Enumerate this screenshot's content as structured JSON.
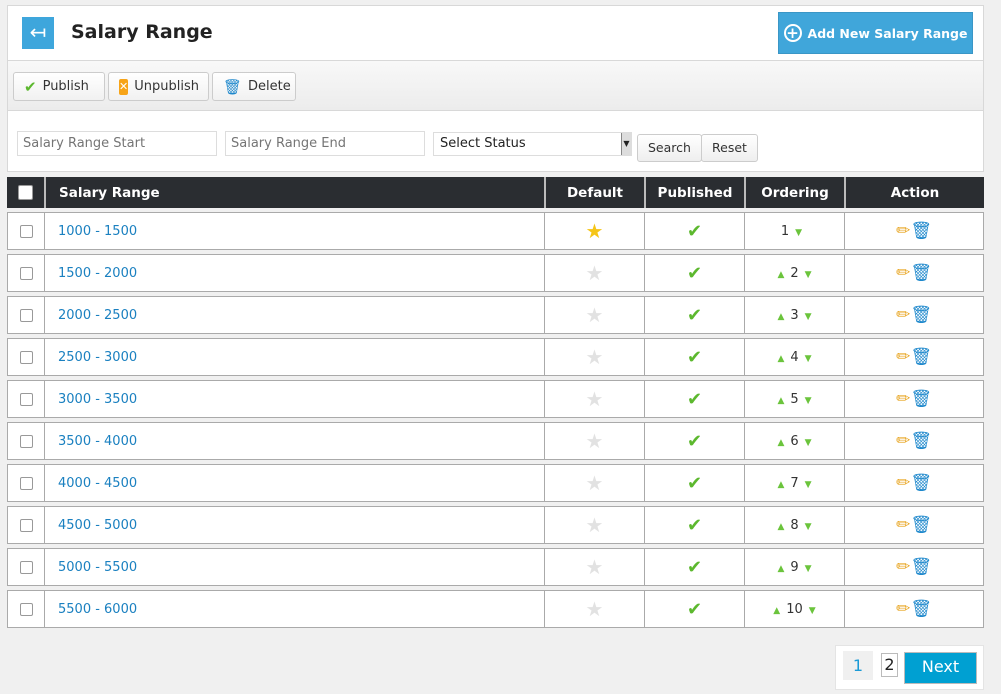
{
  "header": {
    "title": "Salary Range",
    "back_icon": "back-arrow-icon",
    "add_button": "Add New Salary Range"
  },
  "toolbar": {
    "publish": "Publish",
    "unpublish": "Unpublish",
    "delete": "Delete"
  },
  "filters": {
    "start_placeholder": "Salary Range Start",
    "end_placeholder": "Salary Range End",
    "status_selected": "Select Status",
    "search": "Search",
    "reset": "Reset"
  },
  "table": {
    "columns": [
      "Salary Range",
      "Default",
      "Published",
      "Ordering",
      "Action"
    ],
    "rows": [
      {
        "range": "1000 - 1500",
        "default": true,
        "published": true,
        "order": "1"
      },
      {
        "range": "1500 - 2000",
        "default": false,
        "published": true,
        "order": "2"
      },
      {
        "range": "2000 - 2500",
        "default": false,
        "published": true,
        "order": "3"
      },
      {
        "range": "2500 - 3000",
        "default": false,
        "published": true,
        "order": "4"
      },
      {
        "range": "3000 - 3500",
        "default": false,
        "published": true,
        "order": "5"
      },
      {
        "range": "3500 - 4000",
        "default": false,
        "published": true,
        "order": "6"
      },
      {
        "range": "4000 - 4500",
        "default": false,
        "published": true,
        "order": "7"
      },
      {
        "range": "4500 - 5000",
        "default": false,
        "published": true,
        "order": "8"
      },
      {
        "range": "5000 - 5500",
        "default": false,
        "published": true,
        "order": "9"
      },
      {
        "range": "5500 - 6000",
        "default": false,
        "published": true,
        "order": "10"
      }
    ]
  },
  "pagination": {
    "pages": [
      "1",
      "2"
    ],
    "current": "1",
    "next": "Next"
  },
  "colors": {
    "accent": "#40a6da",
    "header_bg": "#2a2d31",
    "link": "#1a80c0",
    "check": "#5cb82e",
    "next_bg": "#00a0d2"
  }
}
